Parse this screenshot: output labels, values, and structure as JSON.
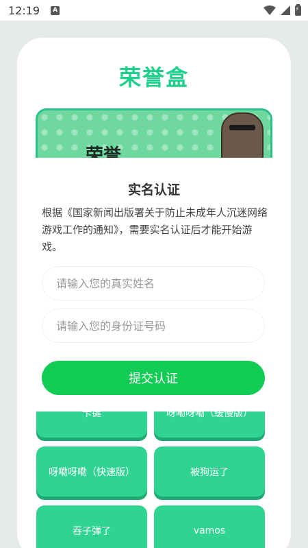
{
  "status_bar": {
    "time": "12:19",
    "notification_icon": "A"
  },
  "app": {
    "title": "荣誉盒",
    "banner_text": "荣誉",
    "accent_color": "#1fcf8d"
  },
  "game_buttons": [
    {
      "label": "卡键"
    },
    {
      "label": "呀嘞呀嘞（缓慢版）"
    },
    {
      "label": "呀嘞呀嘞（快速版）"
    },
    {
      "label": "被狗运了"
    },
    {
      "label": "吞子弹了"
    },
    {
      "label": "vamos"
    }
  ],
  "modal": {
    "title": "实名认证",
    "description": "根据《国家新闻出版署关于防止未成年人沉迷网络游戏工作的通知》，需要实名认证后才能开始游戏。",
    "name_input": {
      "placeholder": "请输入您的真实姓名",
      "value": ""
    },
    "id_input": {
      "placeholder": "请输入您的身份证号码",
      "value": ""
    },
    "submit_label": "提交认证",
    "submit_color": "#13cc55"
  }
}
